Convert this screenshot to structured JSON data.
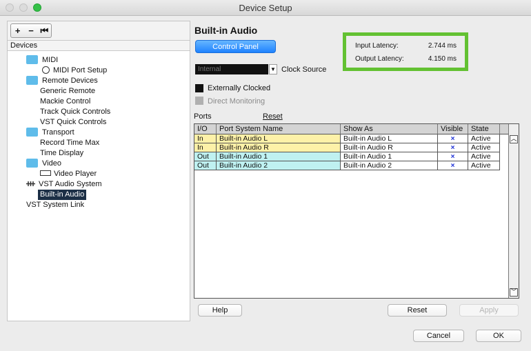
{
  "window": {
    "title": "Device Setup"
  },
  "toolbar": {
    "add": "+",
    "remove": "−",
    "reset": "⏮"
  },
  "devices": {
    "header": "Devices",
    "items": [
      {
        "label": "MIDI",
        "icon": "folder-icon"
      },
      {
        "label": "MIDI Port Setup",
        "icon": "midi-port-icon"
      },
      {
        "label": "Remote Devices",
        "icon": "folder-icon"
      },
      {
        "label": "Generic Remote"
      },
      {
        "label": "Mackie Control"
      },
      {
        "label": "Track Quick Controls"
      },
      {
        "label": "VST Quick Controls"
      },
      {
        "label": "Transport",
        "icon": "folder-icon"
      },
      {
        "label": "Record Time Max"
      },
      {
        "label": "Time Display"
      },
      {
        "label": "Video",
        "icon": "folder-icon"
      },
      {
        "label": "Video Player",
        "icon": "video-icon"
      },
      {
        "label": "VST Audio System",
        "icon": "vst-icon"
      },
      {
        "label": "Built-in Audio",
        "selected": true
      },
      {
        "label": "VST System Link"
      }
    ]
  },
  "main": {
    "title": "Built-in Audio",
    "control_panel": "Control Panel",
    "clock_value": "Internal",
    "clock_label": "Clock Source",
    "externally_clocked": "Externally Clocked",
    "direct_monitoring": "Direct Monitoring",
    "latency": {
      "input_label": "Input Latency:",
      "input_value": "2.744 ms",
      "output_label": "Output Latency:",
      "output_value": "4.150 ms"
    },
    "ports_label": "Ports",
    "reset_link": "Reset"
  },
  "ports_table": {
    "columns": [
      "I/O",
      "Port System Name",
      "Show As",
      "Visible",
      "State"
    ],
    "rows": [
      {
        "io": "In",
        "name": "Built-in Audio L",
        "show_as": "Built-in Audio L",
        "visible": "×",
        "state": "Active"
      },
      {
        "io": "In",
        "name": "Built-in Audio R",
        "show_as": "Built-in Audio R",
        "visible": "×",
        "state": "Active"
      },
      {
        "io": "Out",
        "name": "Built-in Audio 1",
        "show_as": "Built-in Audio 1",
        "visible": "×",
        "state": "Active"
      },
      {
        "io": "Out",
        "name": "Built-in Audio 2",
        "show_as": "Built-in Audio 2",
        "visible": "×",
        "state": "Active"
      }
    ]
  },
  "buttons": {
    "help": "Help",
    "reset": "Reset",
    "apply": "Apply",
    "cancel": "Cancel",
    "ok": "OK"
  },
  "colors": {
    "in_row": "#fdf1a8",
    "out_row": "#bff1f1",
    "accent": "#1f82ff",
    "latency_border": "#63c132",
    "selection": "#1c2f46"
  }
}
